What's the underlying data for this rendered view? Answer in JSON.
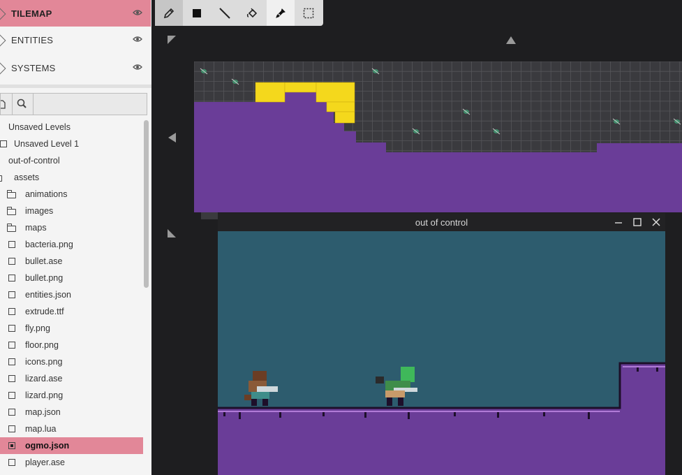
{
  "layers": [
    {
      "label": "TILEMAP",
      "icon": "eye-icon",
      "active": true
    },
    {
      "label": "ENTITIES",
      "icon": "eye-icon",
      "active": false
    },
    {
      "label": "SYSTEMS",
      "icon": "eye-icon",
      "active": false
    }
  ],
  "search": {
    "value": "",
    "placeholder": ""
  },
  "tree": [
    {
      "label": "Unsaved Levels",
      "type": "section"
    },
    {
      "label": "Unsaved Level 1",
      "type": "level"
    },
    {
      "label": "out-of-control",
      "type": "project"
    },
    {
      "label": "assets",
      "type": "folder"
    },
    {
      "label": "animations",
      "type": "folder"
    },
    {
      "label": "images",
      "type": "folder"
    },
    {
      "label": "maps",
      "type": "folder"
    },
    {
      "label": "bacteria.png",
      "type": "file"
    },
    {
      "label": "bullet.ase",
      "type": "file"
    },
    {
      "label": "bullet.png",
      "type": "file"
    },
    {
      "label": "entities.json",
      "type": "file"
    },
    {
      "label": "extrude.ttf",
      "type": "file"
    },
    {
      "label": "fly.png",
      "type": "file"
    },
    {
      "label": "floor.png",
      "type": "file"
    },
    {
      "label": "icons.png",
      "type": "file"
    },
    {
      "label": "lizard.ase",
      "type": "file"
    },
    {
      "label": "lizard.png",
      "type": "file"
    },
    {
      "label": "map.json",
      "type": "file"
    },
    {
      "label": "map.lua",
      "type": "file"
    },
    {
      "label": "ogmo.json",
      "type": "file",
      "selected": true
    },
    {
      "label": "player.ase",
      "type": "file"
    }
  ],
  "toolbar": [
    {
      "name": "pencil-tool",
      "icon": "pencil-icon",
      "active": true
    },
    {
      "name": "rectangle-tool",
      "icon": "filled-square-icon"
    },
    {
      "name": "line-tool",
      "icon": "line-icon"
    },
    {
      "name": "fill-tool",
      "icon": "paint-bucket-icon"
    },
    {
      "name": "eyedropper-tool",
      "icon": "eyedropper-icon",
      "selected": true
    },
    {
      "name": "select-tool",
      "icon": "dashed-rectangle-icon"
    }
  ],
  "game_window": {
    "title": "out of control",
    "buttons": [
      "minimize-icon",
      "maximize-icon",
      "close-icon"
    ]
  },
  "colors": {
    "accent": "#e28798",
    "ground": "#6a3d98",
    "sky": "#2d5c6e",
    "selection_tiles": "#f4d81c",
    "grid": "#56565a"
  }
}
